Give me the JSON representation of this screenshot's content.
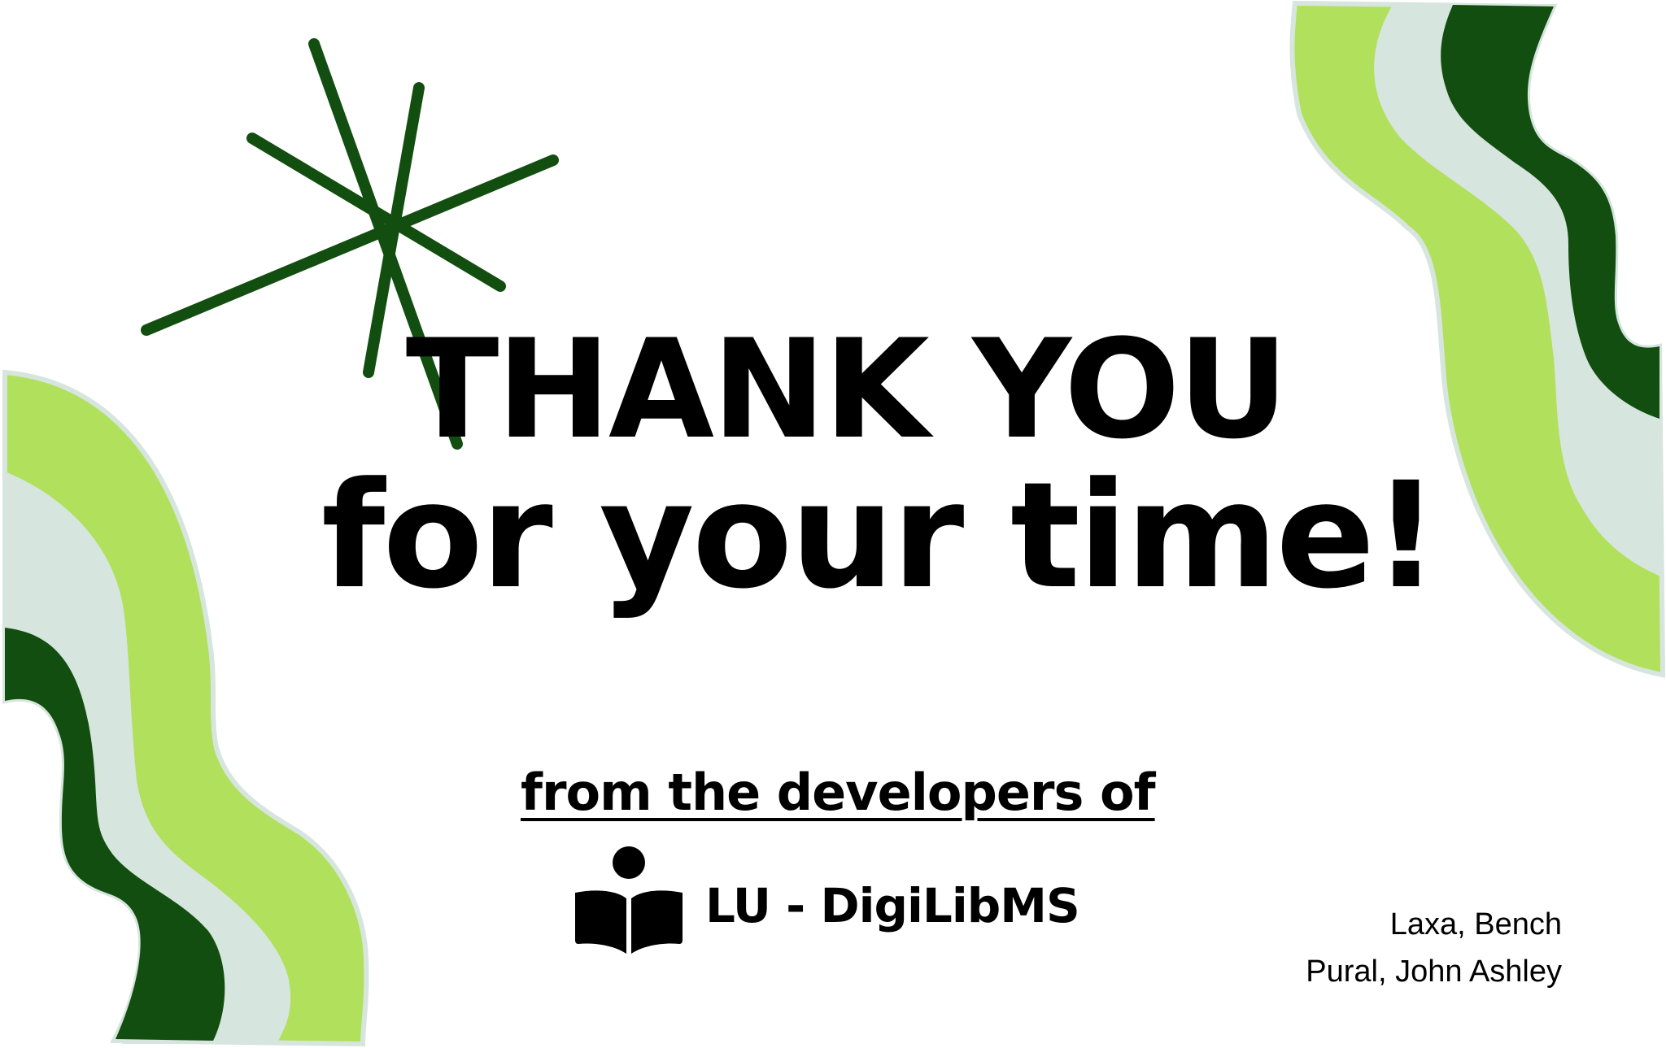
{
  "headline": {
    "line1": "THANK YOU",
    "line2": "for your time!"
  },
  "tagline": "from the developers of",
  "logo": {
    "name": "LU - DigiLibMS",
    "icon": "reader-book-icon"
  },
  "credits": [
    "Laxa, Bench",
    "Pural, John Ashley"
  ],
  "colors": {
    "dark_green": "#124e0f",
    "lime_green": "#b1e05c",
    "pale_green": "#d6e5dd",
    "text": "#000000",
    "background": "#ffffff"
  },
  "decorations": [
    "asterisk-icon",
    "wave-shape-top-right",
    "wave-shape-bottom-left"
  ]
}
